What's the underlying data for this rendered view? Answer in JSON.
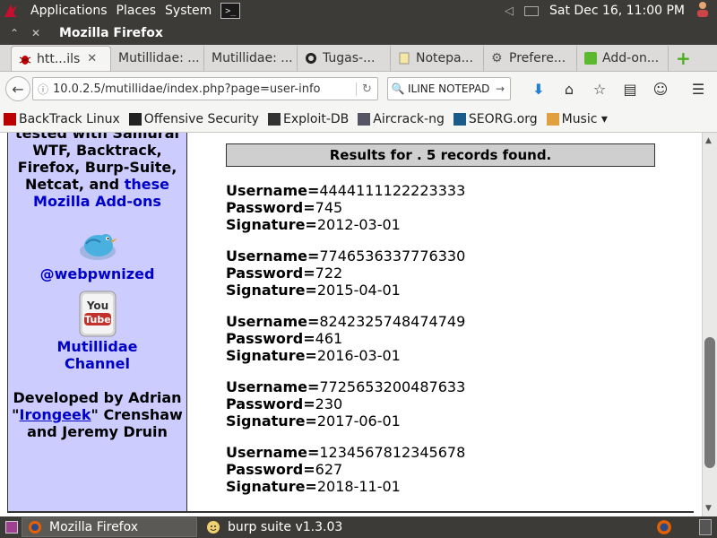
{
  "top_panel": {
    "applications": "Applications",
    "places": "Places",
    "system": "System",
    "datetime": "Sat Dec 16, 11:00 PM"
  },
  "window": {
    "title": "Mozilla Firefox"
  },
  "tabs": [
    {
      "label": "htt...ils"
    },
    {
      "label": "Mutillidae: ..."
    },
    {
      "label": "Mutillidae: ..."
    },
    {
      "label": "Tugas-..."
    },
    {
      "label": "Notepa..."
    },
    {
      "label": "Prefere..."
    },
    {
      "label": "Add-on..."
    }
  ],
  "navigation": {
    "url": "10.0.2.5/mutillidae/index.php?page=user-info",
    "search_value": "ILINE NOTEPAD"
  },
  "bookmarks": [
    {
      "label": "BackTrack Linux"
    },
    {
      "label": "Offensive Security"
    },
    {
      "label": "Exploit-DB"
    },
    {
      "label": "Aircrack-ng"
    },
    {
      "label": "SEORG.org"
    },
    {
      "label": "Music ▾"
    }
  ],
  "sidebar": {
    "line_cut": "tested with Samurai",
    "line1": "WTF, Backtrack,",
    "line2": "Firefox, Burp-Suite,",
    "line3a": "Netcat, and ",
    "line3b": "these",
    "line4": "Mozilla Add-ons",
    "twitter_handle": "@webpwnized",
    "youtube_label1": "Mutillidae",
    "youtube_label2": "Channel",
    "dev_line1": "Developed by Adrian",
    "dev_quote_open": "\"",
    "dev_link": "Irongeek",
    "dev_line2_rest": "\" Crenshaw",
    "dev_line3": "and Jeremy Druin",
    "youtube_logo_you": "You",
    "youtube_logo_tube": "Tube"
  },
  "results": {
    "banner": "Results for . 5 records found.",
    "username_label": "Username=",
    "password_label": "Password=",
    "signature_label": "Signature=",
    "records": [
      {
        "username": "4444111122223333",
        "password": "745",
        "signature": "2012-03-01"
      },
      {
        "username": "7746536337776330",
        "password": "722",
        "signature": "2015-04-01"
      },
      {
        "username": "8242325748474749",
        "password": "461",
        "signature": "2016-03-01"
      },
      {
        "username": "7725653200487633",
        "password": "230",
        "signature": "2017-06-01"
      },
      {
        "username": "1234567812345678",
        "password": "627",
        "signature": "2018-11-01"
      }
    ]
  },
  "taskbar": [
    {
      "label": "Mozilla Firefox"
    },
    {
      "label": "burp suite v1.3.03"
    }
  ]
}
